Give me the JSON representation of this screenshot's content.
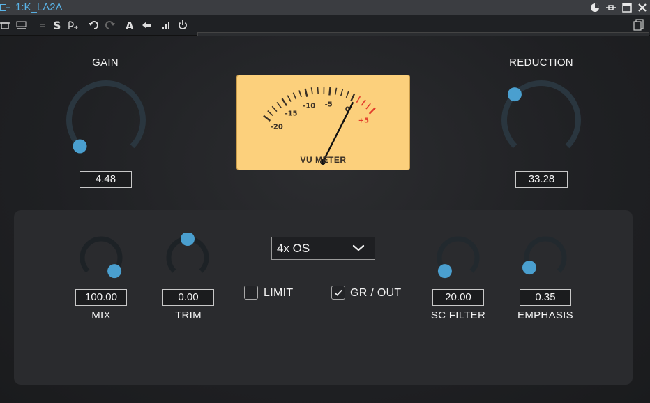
{
  "window": {
    "title": "1:K_LA2A"
  },
  "plugin": {
    "gain": {
      "label": "GAIN",
      "value": "4.48",
      "level": 0.0
    },
    "reduction": {
      "label": "REDUCTION",
      "value": "33.28",
      "level": 0.33
    },
    "vu_meter": {
      "label": "VU METER",
      "scale": [
        "-20",
        "-15",
        "-10",
        "-5",
        "0",
        "+5"
      ],
      "needle_db": 0.5
    },
    "mix": {
      "label": "MIX",
      "value": "100.00",
      "level": 1.0
    },
    "trim": {
      "label": "TRIM",
      "value": "0.00",
      "level": 0.5
    },
    "sc_filter": {
      "label": "SC FILTER",
      "value": "20.00",
      "level": 0.0
    },
    "emphasis": {
      "label": "EMPHASIS",
      "value": "0.35",
      "level": 0.05
    },
    "oversampling": {
      "selected": "4x OS"
    },
    "limit": {
      "label": "LIMIT",
      "checked": false
    },
    "gr_out": {
      "label": "GR / OUT",
      "checked": true
    }
  },
  "colors": {
    "accent": "#4a9fcf",
    "knob_track": "#2a363f",
    "vu_face": "#fcd07c",
    "vu_red": "#e23b2a",
    "title_text": "#5ab4e8"
  }
}
